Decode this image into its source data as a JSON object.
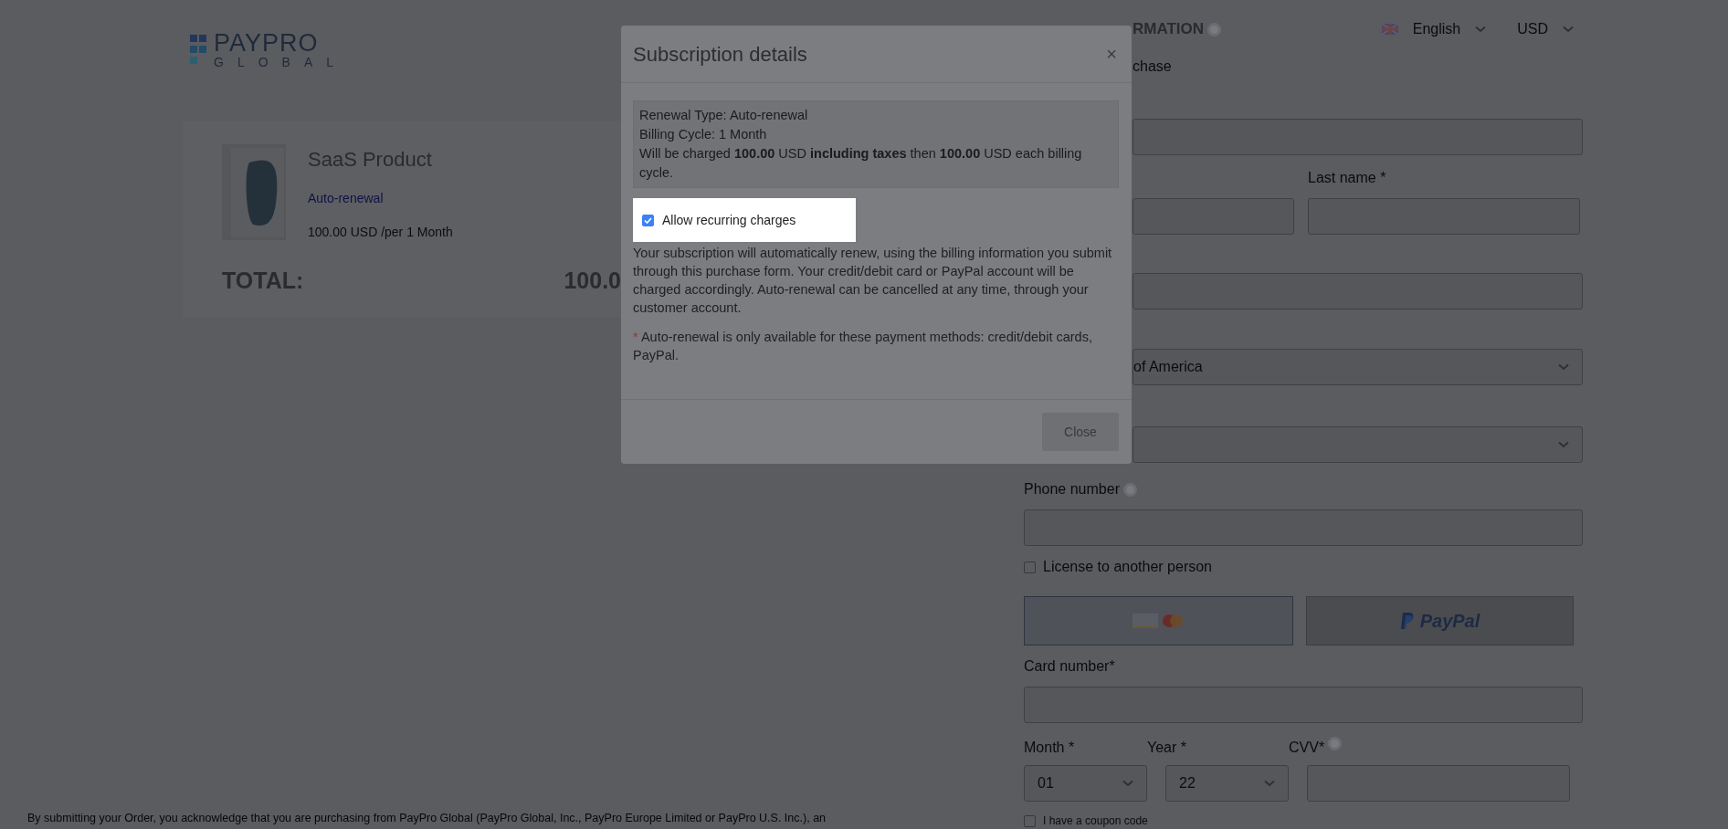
{
  "header": {
    "logo_top": "PAYPRO",
    "logo_bottom": "GLOBAL",
    "language": "English",
    "currency": "USD"
  },
  "product": {
    "name": "SaaS Product",
    "renewal": "Auto-renewal",
    "price": "100.00 USD /per 1 Month",
    "total_label": "TOTAL:",
    "total_value": "100.0"
  },
  "form": {
    "heading": "RMATION",
    "subheading": "chase",
    "last_name_label": "Last name *",
    "country": "of America",
    "phone_label": "Phone number",
    "license": {
      "label": "License to another person",
      "checked": false
    },
    "payment_methods": [
      {
        "kind": "card",
        "selected": true
      },
      {
        "kind": "paypal",
        "label": "PayPal",
        "selected": false
      }
    ],
    "card_number_label": "Card number*",
    "month_label": "Month *",
    "month": "01",
    "year_label": "Year *",
    "year": "22",
    "cvv_label": "CVV*",
    "coupon": {
      "label": "I have a coupon code",
      "checked": false
    }
  },
  "footer": "By submitting your Order, you acknowledge that you are purchasing from PayPro Global (PayPro Global, Inc., PayPro Europe Limited or PayPro U.S. Inc.), an",
  "modal": {
    "title": "Subscription details",
    "close_icon": "×",
    "info_lines": [
      "Renewal Type: Auto-renewal",
      "Billing Cycle: 1 Month",
      "Will be charged **100.00** USD **including taxes** then **100.00** USD each billing cycle."
    ],
    "recurring": {
      "label": "Allow recurring charges",
      "checked": true
    },
    "description": "Your subscription will automatically renew, using the billing information you submit through this purchase form. Your credit/debit card or PayPal account will be charged accordingly. Auto-renewal can be cancelled at any time, through your customer account.",
    "note_mark": "*",
    "note": "Auto-renewal is only available for these payment methods: credit/debit cards, PayPal.",
    "close_button": "Close"
  }
}
